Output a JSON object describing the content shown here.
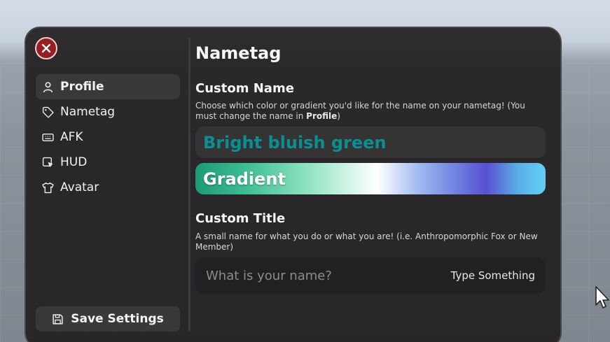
{
  "window": {
    "close_icon": "close-icon"
  },
  "sidebar": {
    "items": [
      {
        "label": "Profile",
        "icon": "user-icon"
      },
      {
        "label": "Nametag",
        "icon": "tag-icon"
      },
      {
        "label": "AFK",
        "icon": "keyboard-icon"
      },
      {
        "label": "HUD",
        "icon": "pointer-icon"
      },
      {
        "label": "Avatar",
        "icon": "shirt-icon"
      }
    ],
    "active_index": 0,
    "save_label": "Save Settings",
    "save_icon": "floppy-disk-icon"
  },
  "main": {
    "title": "Nametag",
    "custom_name": {
      "heading": "Custom Name",
      "description_prefix": "Choose which color or gradient you'd like for the name on your nametag! (You must change the name in ",
      "description_link": "Profile",
      "description_suffix": ")",
      "color_option_label": "Bright bluish green",
      "color_option_color": "#0b8f92",
      "gradient_option_label": "Gradient"
    },
    "custom_title": {
      "heading": "Custom Title",
      "description": "A small name for what you do or what you are! (i.e. Anthropomorphic Fox or New Member)",
      "input_placeholder": "What is your name?",
      "input_hint": "Type Something"
    }
  },
  "colors": {
    "panel_bg": "#221f21",
    "close_button": "#9a1d22",
    "accent_text": "#0b8f92"
  }
}
